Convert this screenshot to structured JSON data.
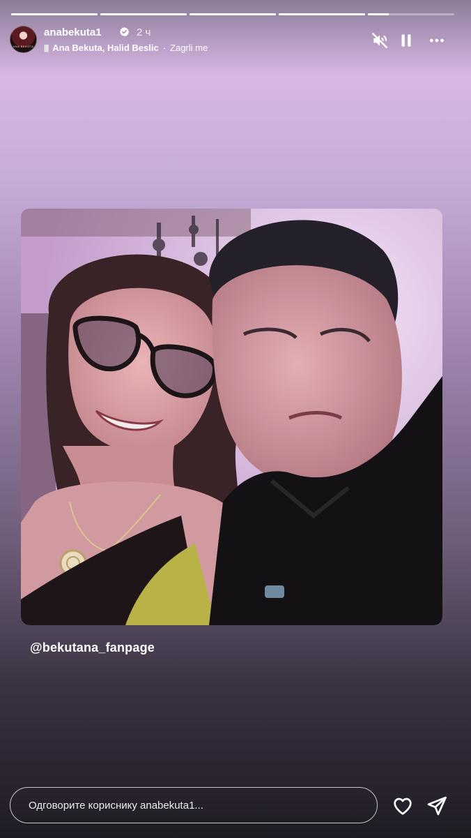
{
  "story": {
    "progress": [
      1,
      1,
      1,
      1,
      0.24
    ]
  },
  "header": {
    "username": "anabekuta1",
    "time": "2 ч",
    "music": {
      "artists": "Ana Bekuta, Halid Beslic",
      "separator": "·",
      "song": "Zagrli me"
    },
    "avatar_text": "ANA BEKUTA"
  },
  "content": {
    "mention": "@bekutana_fanpage"
  },
  "reply": {
    "placeholder": "Одговорите кориснику anabekuta1..."
  },
  "icons": {
    "verified": "verified-badge-icon",
    "mute": "muted-speaker-icon",
    "pause": "pause-icon",
    "more": "more-options-icon",
    "like": "heart-icon",
    "share": "send-icon"
  }
}
